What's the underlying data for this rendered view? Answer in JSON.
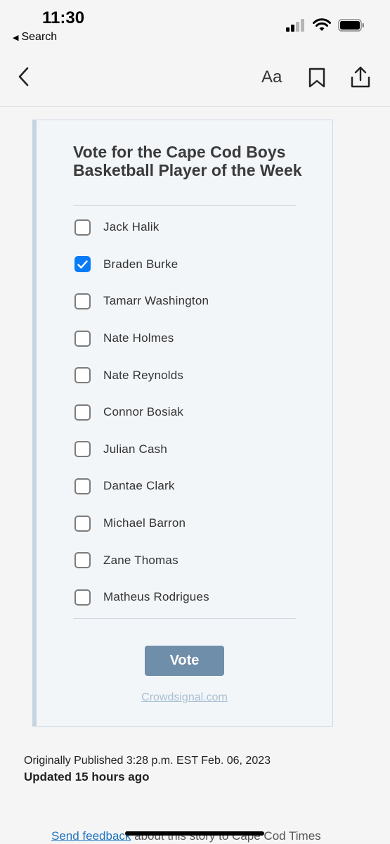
{
  "status_bar": {
    "time": "11:30",
    "back_label": "Search"
  },
  "toolbar": {
    "text_size_label": "Aa"
  },
  "poll": {
    "title": "Vote for the Cape Cod Boys Basketball Player of the Week",
    "options": [
      {
        "label": "Jack Halik",
        "checked": false
      },
      {
        "label": "Braden Burke",
        "checked": true
      },
      {
        "label": "Tamarr Washington",
        "checked": false
      },
      {
        "label": "Nate Holmes",
        "checked": false
      },
      {
        "label": "Nate Reynolds",
        "checked": false
      },
      {
        "label": "Connor Bosiak",
        "checked": false
      },
      {
        "label": "Julian Cash",
        "checked": false
      },
      {
        "label": "Dantae Clark",
        "checked": false
      },
      {
        "label": "Michael Barron",
        "checked": false
      },
      {
        "label": "Zane Thomas",
        "checked": false
      },
      {
        "label": "Matheus Rodrigues",
        "checked": false
      }
    ],
    "vote_label": "Vote",
    "provider_link": "Crowdsignal.com"
  },
  "article_meta": {
    "published": "Originally Published 3:28 p.m. EST Feb. 06, 2023",
    "updated": "Updated 15 hours ago"
  },
  "footer": {
    "feedback_link": "Send feedback",
    "feedback_text": " about this story to Cape Cod Times"
  },
  "colors": {
    "accent": "#0a7bf6",
    "vote_button": "#6f8ea9",
    "link": "#1e73be"
  }
}
